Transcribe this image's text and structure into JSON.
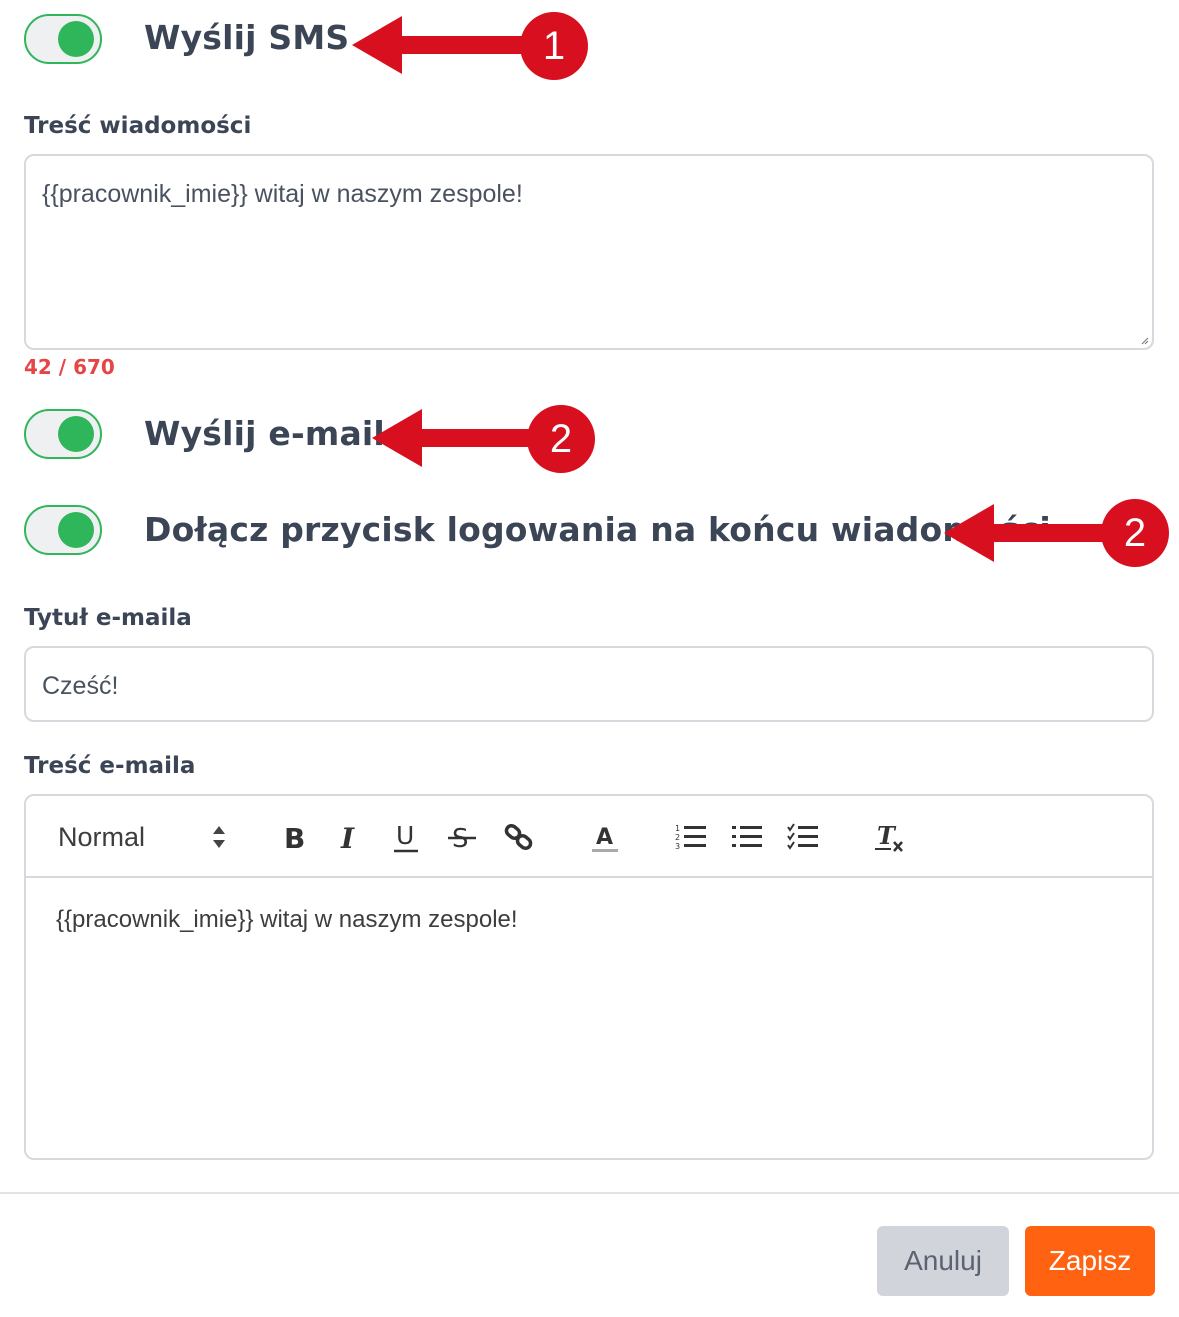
{
  "sms": {
    "toggle_label": "Wyślij SMS",
    "toggle_on": true,
    "message_label": "Treść wiadomości",
    "message_value": "{{pracownik_imie}} witaj w naszym zespole!",
    "counter": "42 / 670"
  },
  "email": {
    "toggle_label": "Wyślij e-mail",
    "toggle_on": true,
    "login_toggle_label": "Dołącz przycisk logowania na końcu wiadomości",
    "login_toggle_on": true,
    "title_label": "Tytuł e-maila",
    "title_value": "Cześć!",
    "body_label": "Treść e-maila",
    "body_value": "{{pracownik_imie}} witaj w naszym zespole!"
  },
  "editor_toolbar": {
    "format_select": "Normal",
    "tools": [
      "bold-icon",
      "italic-icon",
      "underline-icon",
      "strike-icon",
      "link-icon",
      "text-color-icon",
      "ordered-list-icon",
      "bullet-list-icon",
      "check-list-icon",
      "clear-format-icon"
    ]
  },
  "annotations": {
    "badge_1": "1",
    "badge_2": "2",
    "badge_3": "2",
    "color": "#d80f1e"
  },
  "footer": {
    "cancel_label": "Anuluj",
    "save_label": "Zapisz"
  },
  "colors": {
    "toggle_on": "#2fb55a",
    "save_button": "#ff6210",
    "counter": "#e64545"
  }
}
